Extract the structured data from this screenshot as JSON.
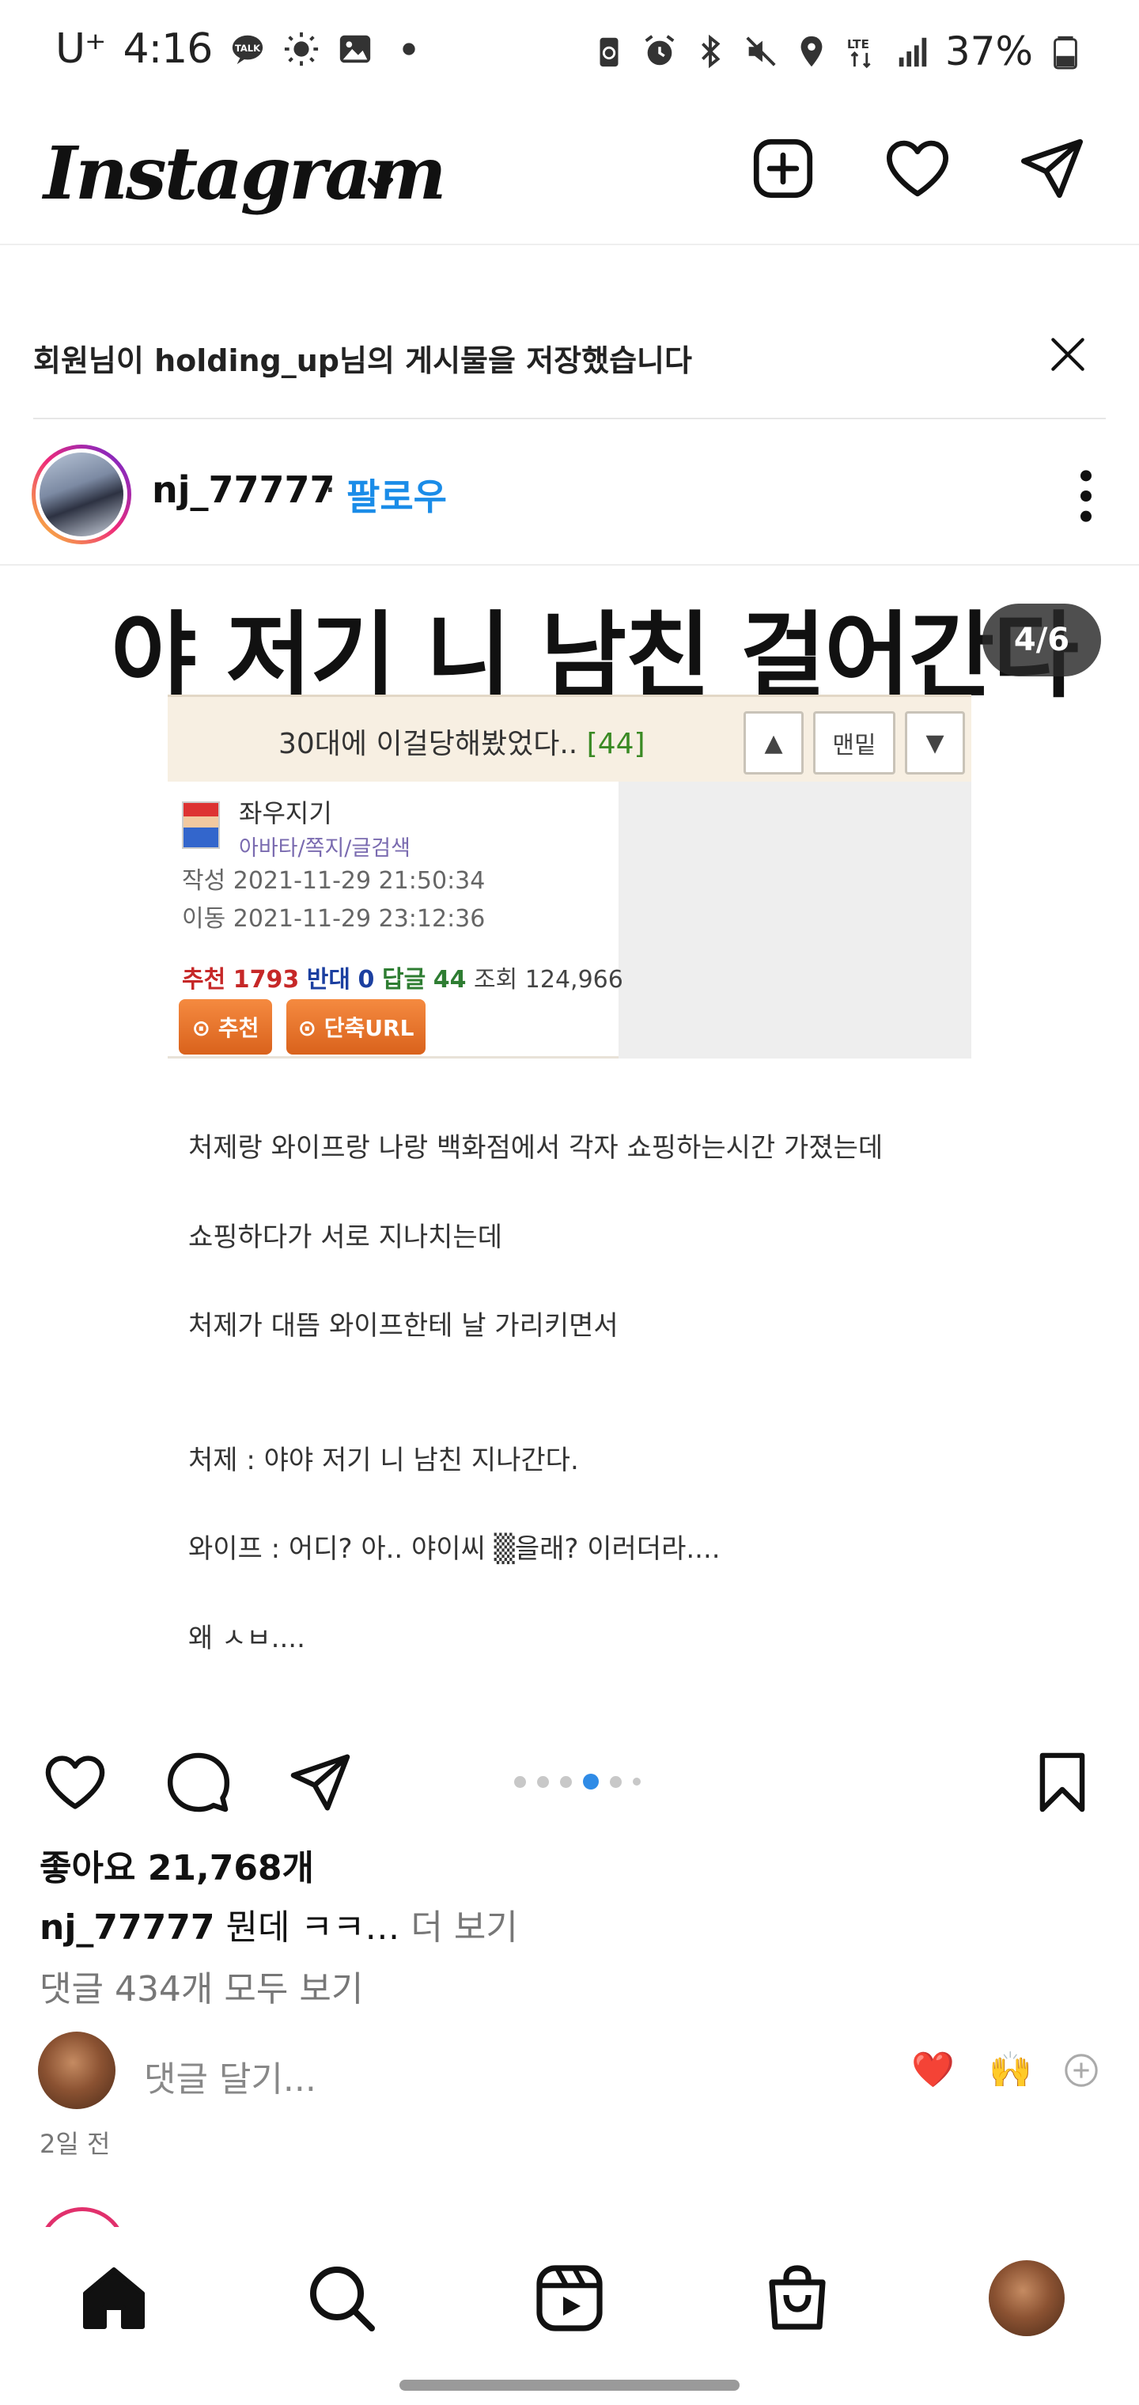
{
  "status_bar": {
    "carrier": "U⁺",
    "time": "4:16",
    "battery": "37%"
  },
  "header": {
    "logo": "Instagram"
  },
  "notice": {
    "text": "회원님이 holding_up님의 게시물을 저장했습니다"
  },
  "post": {
    "username": "nj_77777",
    "separator": "·",
    "follow_label": "팔로우",
    "headline": "야 저기 니 남친 걸어간다",
    "carousel_counter": "4/6",
    "board": {
      "title": "30대에 이걸당해봤었다..",
      "reply_count": "[44]",
      "up_btn": "▲",
      "bottom_btn": "맨밑",
      "down_btn": "▼",
      "author": "좌우지기",
      "author_links": "아바타/쪽지/글검색",
      "written": "작성 2021-11-29 21:50:34",
      "moved": "이동 2021-11-29 23:12:36",
      "stat_recommend_label": "추천",
      "stat_recommend": "1793",
      "stat_oppose_label": "반대",
      "stat_oppose": "0",
      "stat_reply_label": "답글",
      "stat_reply": "44",
      "stat_view_label": "조회",
      "stat_view": "124,966",
      "btn_recommend": "⊙ 추천",
      "btn_short_url": "⊙ 단축URL"
    },
    "story_lines": [
      "처제랑 와이프랑 나랑 백화점에서 각자 쇼핑하는시간 가졌는데",
      "쇼핑하다가 서로 지나치는데",
      "처제가 대뜸 와이프한테 날 가리키면서",
      "처제 : 야야 저기 니 남친 지나간다.",
      "와이프 : 어디? 아.. 야이씨 ▒을래? 이러더라....",
      "왜 ㅅㅂ...."
    ],
    "likes": "좋아요 21,768개",
    "caption_user": "nj_77777",
    "caption_text": "뭔데 ㅋㅋ…",
    "caption_more": "더 보기",
    "view_comments": "댓글 434개 모두 보기",
    "comment_placeholder": "댓글 달기...",
    "reaction_1": "❤️",
    "reaction_2": "🙌",
    "time_ago": "2일 전"
  },
  "carousel": {
    "total": 6,
    "active_index": 3
  },
  "icons": {
    "header": [
      "add-post-icon",
      "heart-icon",
      "direct-message-icon"
    ],
    "actions": [
      "like-icon",
      "comment-icon",
      "share-icon",
      "save-icon"
    ],
    "nav": [
      "home-icon",
      "search-icon",
      "reels-icon",
      "shop-icon",
      "profile-avatar"
    ]
  },
  "colors": {
    "follow_blue": "#1a8ce8",
    "dot_active": "#2f8be6",
    "board_green": "#3a8a24"
  }
}
